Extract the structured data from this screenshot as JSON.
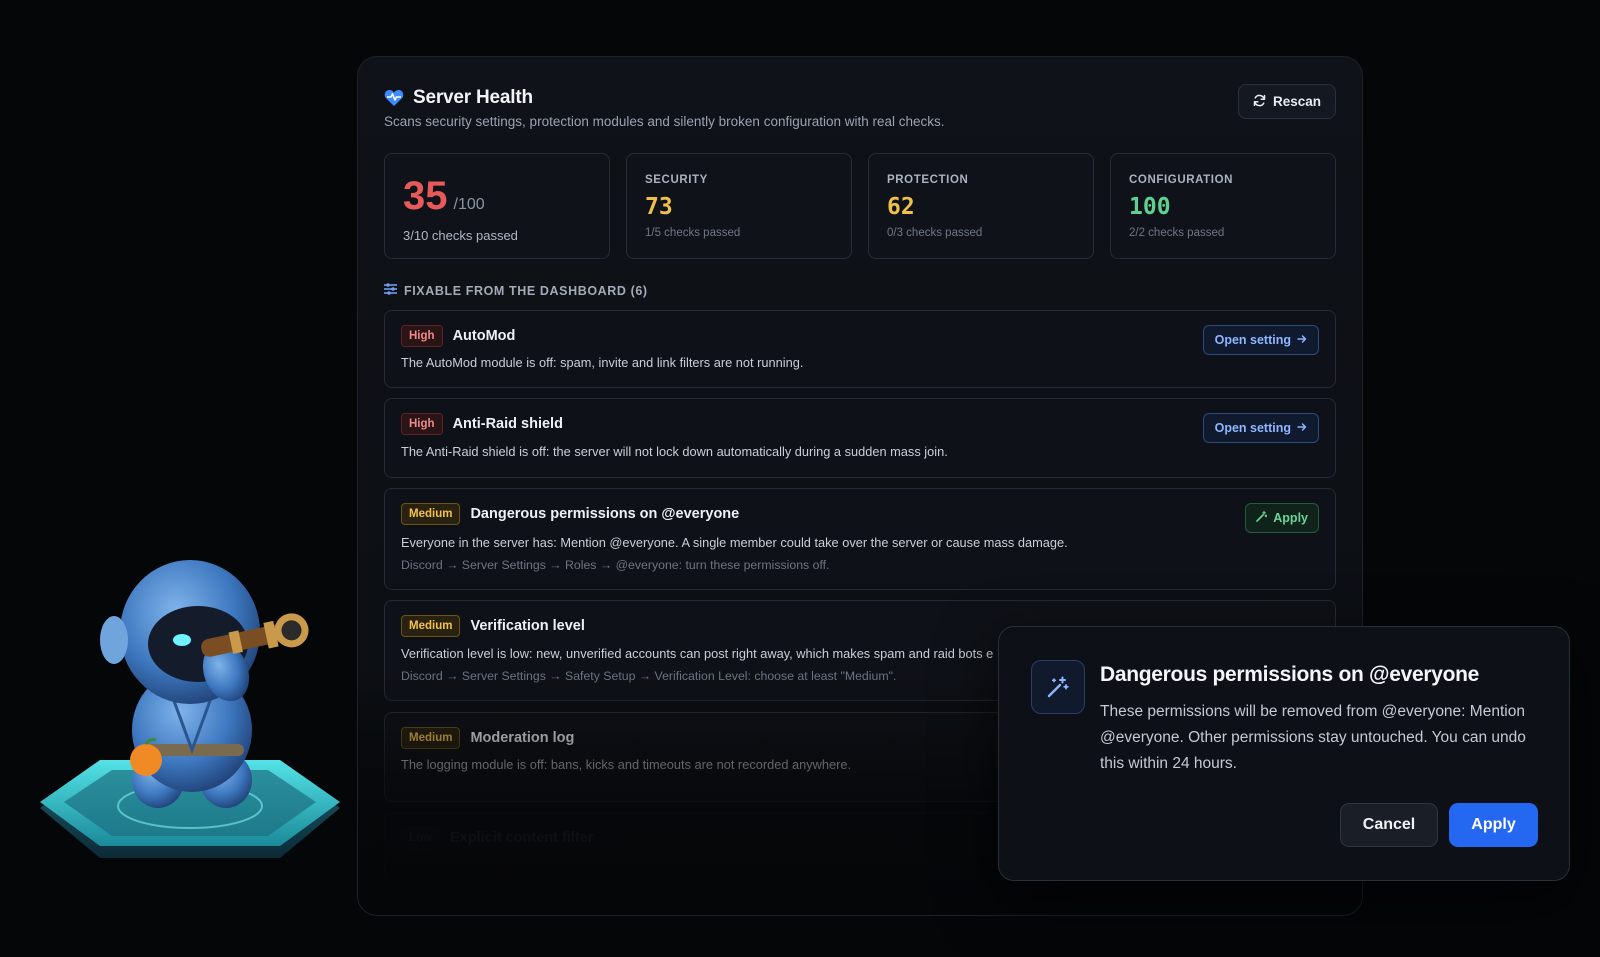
{
  "header": {
    "title": "Server Health",
    "subtitle": "Scans security settings, protection modules and silently broken configuration with real checks.",
    "rescan_label": "Rescan"
  },
  "scores": {
    "total": {
      "value": "35",
      "denominator": "/100",
      "checks": "3/10 checks passed",
      "color": "#e85a5a"
    },
    "cards": [
      {
        "label": "SECURITY",
        "value": "73",
        "checks": "1/5 checks passed",
        "color": "#f0c04a"
      },
      {
        "label": "PROTECTION",
        "value": "62",
        "checks": "0/3 checks passed",
        "color": "#f0c04a"
      },
      {
        "label": "CONFIGURATION",
        "value": "100",
        "checks": "2/2 checks passed",
        "color": "#5fd08f"
      }
    ]
  },
  "section": {
    "label": "FIXABLE FROM THE DASHBOARD (6)"
  },
  "issues": [
    {
      "severity": "High",
      "title": "AutoMod",
      "description": "The AutoMod module is off: spam, invite and link filters are not running.",
      "action": "Open setting"
    },
    {
      "severity": "High",
      "title": "Anti-Raid shield",
      "description": "The Anti-Raid shield is off: the server will not lock down automatically during a sudden mass join.",
      "action": "Open setting"
    },
    {
      "severity": "Medium",
      "title": "Dangerous permissions on @everyone",
      "description": "Everyone in the server has: Mention @everyone. A single member could take over the server or cause mass damage.",
      "path": "Discord → Server Settings → Roles → @everyone: turn these permissions off.",
      "action": "Apply"
    },
    {
      "severity": "Medium",
      "title": "Verification level",
      "description": "Verification level is low: new, unverified accounts can post right away, which makes spam and raid bots e",
      "path": "Discord → Server Settings → Safety Setup → Verification Level: choose at least \"Medium\"."
    },
    {
      "severity": "Medium",
      "title": "Moderation log",
      "description": "The logging module is off: bans, kicks and timeouts are not recorded anywhere."
    },
    {
      "severity": "Low",
      "title": "Explicit content filter"
    }
  ],
  "modal": {
    "title": "Dangerous permissions on @everyone",
    "body": "These permissions will be removed from @everyone: Mention @everyone. Other permissions stay untouched. You can undo this within 24 hours.",
    "cancel_label": "Cancel",
    "apply_label": "Apply"
  },
  "icons": {
    "heart": "heart-pulse-icon",
    "rescan": "refresh-icon",
    "section": "sliders-icon",
    "arrow": "arrow-right-icon",
    "wand": "magic-wand-icon"
  },
  "colors": {
    "accent": "#2467f0",
    "high": "#f08a8a",
    "medium": "#f3c24a",
    "success": "#6ed39b"
  }
}
